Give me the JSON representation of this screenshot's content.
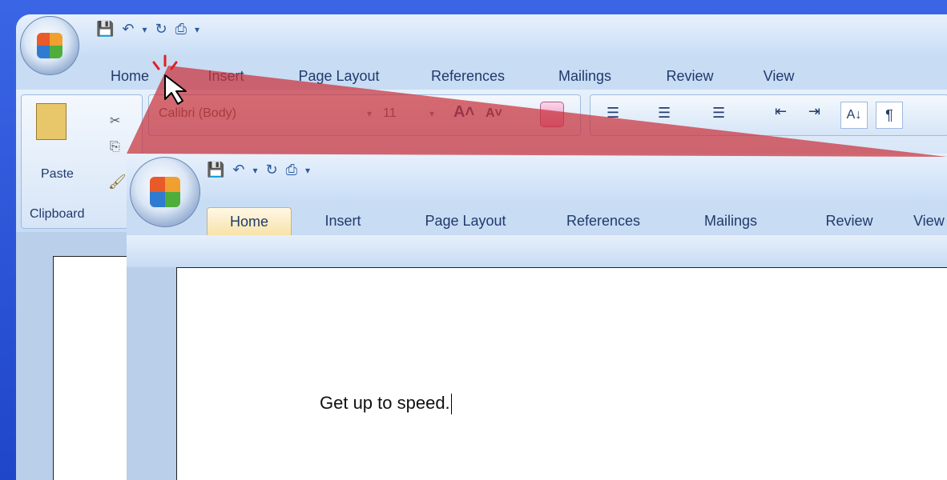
{
  "back_window": {
    "qat": {
      "save_icon": "save-icon",
      "undo_icon": "undo-icon",
      "redo_icon": "redo-icon",
      "print_icon": "quick-print-icon",
      "customize_icon": "customize-qat-icon"
    },
    "tabs": [
      {
        "label": "Home",
        "active": true
      },
      {
        "label": "Insert"
      },
      {
        "label": "Page Layout"
      },
      {
        "label": "References"
      },
      {
        "label": "Mailings"
      },
      {
        "label": "Review"
      },
      {
        "label": "View"
      }
    ],
    "ribbon": {
      "clipboard": {
        "paste_label": "Paste",
        "group_label": "Clipboard"
      },
      "font": {
        "name": "Calibri (Body)",
        "size": "11"
      }
    }
  },
  "front_window": {
    "tabs": [
      {
        "label": "Home",
        "active": true
      },
      {
        "label": "Insert"
      },
      {
        "label": "Page Layout"
      },
      {
        "label": "References"
      },
      {
        "label": "Mailings"
      },
      {
        "label": "Review"
      },
      {
        "label": "View"
      }
    ],
    "document_text": "Get up to speed."
  },
  "colors": {
    "highlight": "#c9323a",
    "accent": "#2a54d6"
  }
}
